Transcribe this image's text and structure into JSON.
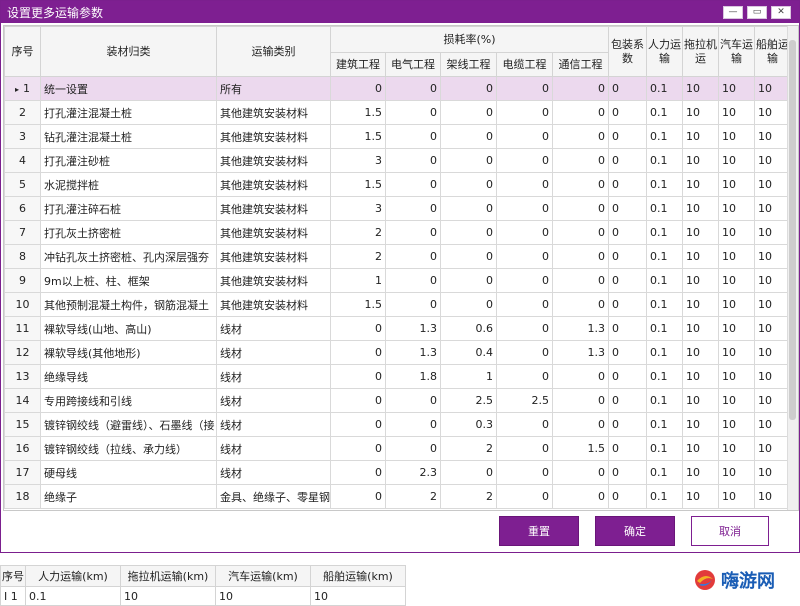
{
  "dialog": {
    "title": "设置更多运输参数",
    "win": {
      "min": "—",
      "max": "▭",
      "close": "✕"
    }
  },
  "grid": {
    "headers": {
      "idx": "序号",
      "category": "装材归类",
      "transport_type": "运输类别",
      "loss_group": "损耗率(%)",
      "loss_cols": [
        "建筑工程",
        "电气工程",
        "架线工程",
        "电缆工程",
        "通信工程"
      ],
      "pack": "包装系数",
      "manual": "人力运输",
      "tractor": "拖拉机运",
      "truck": "汽车运输",
      "ship": "船舶运输"
    },
    "selected_marker": "▸",
    "rows": [
      {
        "idx": "1",
        "category": "统一设置",
        "type": "所有",
        "loss": [
          "0",
          "0",
          "0",
          "0",
          "0"
        ],
        "pack": "0",
        "manual": "0.1",
        "tractor": "10",
        "truck": "10",
        "ship": "10"
      },
      {
        "idx": "2",
        "category": "打孔灌注混凝土桩",
        "type": "其他建筑安装材料",
        "loss": [
          "1.5",
          "0",
          "0",
          "0",
          "0"
        ],
        "pack": "0",
        "manual": "0.1",
        "tractor": "10",
        "truck": "10",
        "ship": "10"
      },
      {
        "idx": "3",
        "category": "钻孔灌注混凝土桩",
        "type": "其他建筑安装材料",
        "loss": [
          "1.5",
          "0",
          "0",
          "0",
          "0"
        ],
        "pack": "0",
        "manual": "0.1",
        "tractor": "10",
        "truck": "10",
        "ship": "10"
      },
      {
        "idx": "4",
        "category": "打孔灌注砂桩",
        "type": "其他建筑安装材料",
        "loss": [
          "3",
          "0",
          "0",
          "0",
          "0"
        ],
        "pack": "0",
        "manual": "0.1",
        "tractor": "10",
        "truck": "10",
        "ship": "10"
      },
      {
        "idx": "5",
        "category": "水泥搅拌桩",
        "type": "其他建筑安装材料",
        "loss": [
          "1.5",
          "0",
          "0",
          "0",
          "0"
        ],
        "pack": "0",
        "manual": "0.1",
        "tractor": "10",
        "truck": "10",
        "ship": "10"
      },
      {
        "idx": "6",
        "category": "打孔灌注碎石桩",
        "type": "其他建筑安装材料",
        "loss": [
          "3",
          "0",
          "0",
          "0",
          "0"
        ],
        "pack": "0",
        "manual": "0.1",
        "tractor": "10",
        "truck": "10",
        "ship": "10"
      },
      {
        "idx": "7",
        "category": "打孔灰土挤密桩",
        "type": "其他建筑安装材料",
        "loss": [
          "2",
          "0",
          "0",
          "0",
          "0"
        ],
        "pack": "0",
        "manual": "0.1",
        "tractor": "10",
        "truck": "10",
        "ship": "10"
      },
      {
        "idx": "8",
        "category": "冲钻孔灰土挤密桩、孔内深层强夯",
        "type": "其他建筑安装材料",
        "loss": [
          "2",
          "0",
          "0",
          "0",
          "0"
        ],
        "pack": "0",
        "manual": "0.1",
        "tractor": "10",
        "truck": "10",
        "ship": "10"
      },
      {
        "idx": "9",
        "category": "9m以上桩、柱、框架",
        "type": "其他建筑安装材料",
        "loss": [
          "1",
          "0",
          "0",
          "0",
          "0"
        ],
        "pack": "0",
        "manual": "0.1",
        "tractor": "10",
        "truck": "10",
        "ship": "10"
      },
      {
        "idx": "10",
        "category": "其他预制混凝土构件，钢筋混凝土",
        "type": "其他建筑安装材料",
        "loss": [
          "1.5",
          "0",
          "0",
          "0",
          "0"
        ],
        "pack": "0",
        "manual": "0.1",
        "tractor": "10",
        "truck": "10",
        "ship": "10"
      },
      {
        "idx": "11",
        "category": "裸软导线(山地、高山)",
        "type": "线材",
        "loss": [
          "0",
          "1.3",
          "0.6",
          "0",
          "1.3"
        ],
        "pack": "0",
        "manual": "0.1",
        "tractor": "10",
        "truck": "10",
        "ship": "10"
      },
      {
        "idx": "12",
        "category": "裸软导线(其他地形)",
        "type": "线材",
        "loss": [
          "0",
          "1.3",
          "0.4",
          "0",
          "1.3"
        ],
        "pack": "0",
        "manual": "0.1",
        "tractor": "10",
        "truck": "10",
        "ship": "10"
      },
      {
        "idx": "13",
        "category": "绝缘导线",
        "type": "线材",
        "loss": [
          "0",
          "1.8",
          "1",
          "0",
          "0"
        ],
        "pack": "0",
        "manual": "0.1",
        "tractor": "10",
        "truck": "10",
        "ship": "10"
      },
      {
        "idx": "14",
        "category": "专用跨接线和引线",
        "type": "线材",
        "loss": [
          "0",
          "0",
          "2.5",
          "2.5",
          "0"
        ],
        "pack": "0",
        "manual": "0.1",
        "tractor": "10",
        "truck": "10",
        "ship": "10"
      },
      {
        "idx": "15",
        "category": "镀锌钢绞线（避雷线）、石墨线（接",
        "type": "线材",
        "loss": [
          "0",
          "0",
          "0.3",
          "0",
          "0"
        ],
        "pack": "0",
        "manual": "0.1",
        "tractor": "10",
        "truck": "10",
        "ship": "10"
      },
      {
        "idx": "16",
        "category": "镀锌钢绞线（拉线、承力线）",
        "type": "线材",
        "loss": [
          "0",
          "0",
          "2",
          "0",
          "1.5"
        ],
        "pack": "0",
        "manual": "0.1",
        "tractor": "10",
        "truck": "10",
        "ship": "10"
      },
      {
        "idx": "17",
        "category": "硬母线",
        "type": "线材",
        "loss": [
          "0",
          "2.3",
          "0",
          "0",
          "0"
        ],
        "pack": "0",
        "manual": "0.1",
        "tractor": "10",
        "truck": "10",
        "ship": "10"
      },
      {
        "idx": "18",
        "category": "绝缘子",
        "type": "金具、绝缘子、零星钢",
        "loss": [
          "0",
          "2",
          "2",
          "0",
          "0"
        ],
        "pack": "0",
        "manual": "0.1",
        "tractor": "10",
        "truck": "10",
        "ship": "10"
      }
    ]
  },
  "buttons": {
    "reset": "重置",
    "ok": "确定",
    "cancel": "取消"
  },
  "bottom": {
    "headers": [
      "序号",
      "人力运输(km)",
      "拖拉机运输(km)",
      "汽车运输(km)",
      "船舶运输(km)"
    ],
    "row": {
      "marker": "I",
      "idx": "1",
      "manual": "0.1",
      "tractor": "10",
      "truck": "10",
      "ship": "10"
    }
  },
  "logo": {
    "text": "嗨游网"
  }
}
